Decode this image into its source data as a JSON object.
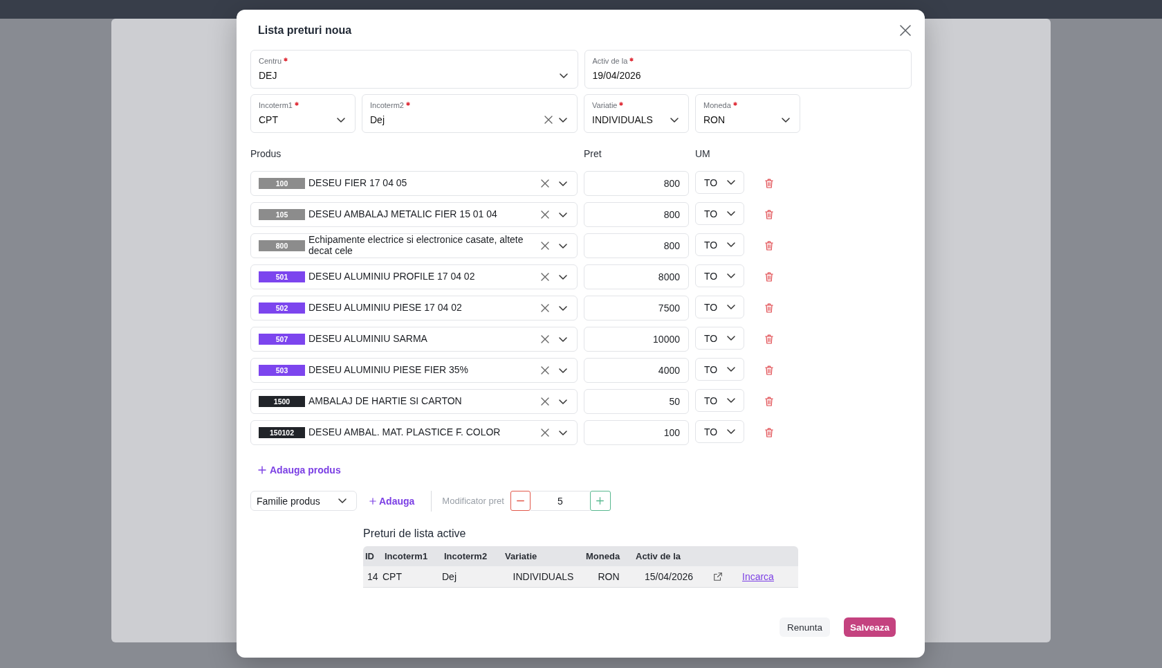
{
  "dialog": {
    "title": "Lista preturi noua"
  },
  "fields_top": [
    {
      "kind": "select",
      "label": "Centru",
      "required": true,
      "value": "DEJ",
      "clearable": false
    },
    {
      "kind": "date",
      "label": "Activ de la",
      "required": true,
      "value": "19/04/2026",
      "clearable": false
    }
  ],
  "fields_terms": [
    {
      "kind": "select",
      "label": "Incoterm1",
      "required": true,
      "value": "CPT",
      "clearable": false
    },
    {
      "kind": "select",
      "label": "Incoterm2",
      "required": true,
      "value": "Dej",
      "clearable": true
    },
    {
      "kind": "select",
      "label": "Variatie",
      "required": true,
      "value": "INDIVIDUALS",
      "clearable": false
    },
    {
      "kind": "select",
      "label": "Moneda",
      "required": true,
      "value": "RON",
      "clearable": false
    }
  ],
  "products": {
    "columns": [
      "Produs",
      "Pret",
      "UM"
    ],
    "rows": [
      {
        "code": "100",
        "color": "#8c8c8c",
        "name": "DESEU FIER 17 04 05",
        "price": "800",
        "unit": "TO"
      },
      {
        "code": "105",
        "color": "#8c8c8c",
        "name": "DESEU AMBALAJ METALIC FIER 15 01 04",
        "price": "800",
        "unit": "TO"
      },
      {
        "code": "800",
        "color": "#8c8c8c",
        "name": "Echipamente electrice si electronice casate, altete decat cele",
        "price": "800",
        "unit": "TO"
      },
      {
        "code": "501",
        "color": "#7c45ee",
        "name": "DESEU ALUMINIU PROFILE 17 04 02",
        "price": "8000",
        "unit": "TO"
      },
      {
        "code": "502",
        "color": "#7c45ee",
        "name": "DESEU ALUMINIU PIESE 17 04 02",
        "price": "7500",
        "unit": "TO"
      },
      {
        "code": "507",
        "color": "#7c45ee",
        "name": "DESEU ALUMINIU SARMA",
        "price": "10000",
        "unit": "TO"
      },
      {
        "code": "503",
        "color": "#7c45ee",
        "name": "DESEU ALUMINIU PIESE FIER 35%",
        "price": "4000",
        "unit": "TO"
      },
      {
        "code": "1500",
        "color": "#212429",
        "name": "AMBALAJ DE HARTIE SI CARTON",
        "price": "50",
        "unit": "TO"
      },
      {
        "code": "150102",
        "color": "#212429",
        "name": "DESEU AMBAL. MAT. PLASTICE F. COLOR",
        "price": "100",
        "unit": "TO"
      }
    ]
  },
  "add_product": "Adauga produs",
  "toolbar": {
    "family_select": "Familie produs",
    "add_button": "Adauga",
    "modifier": {
      "label": "Modificator pret",
      "value": "5"
    }
  },
  "active_price_lists": {
    "title": "Preturi de lista active",
    "columns": [
      "ID",
      "Incoterm1",
      "Incoterm2",
      "Variatie",
      "Moneda",
      "Activ de la"
    ],
    "rows": [
      {
        "cells": [
          "14",
          "CPT",
          "Dej",
          "INDIVIDUALS",
          "RON",
          "15/04/2026"
        ],
        "link": "Incarca"
      }
    ]
  },
  "buttons": [
    {
      "kind": "secondary",
      "label": "Renunta"
    },
    {
      "kind": "primary",
      "label": "Salveaza"
    }
  ]
}
